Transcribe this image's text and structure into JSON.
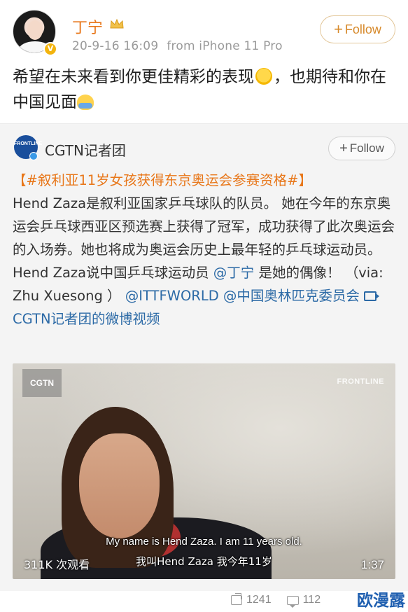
{
  "post": {
    "username": "丁宁",
    "timestamp": "20-9-16 16:09",
    "source": "from iPhone 11 Pro",
    "follow_label": "Follow",
    "text_part1": "希望在未来看到你更佳精彩的表现",
    "text_part2": "，也期待和你在中国见面",
    "emoji_1": "sun-face-icon",
    "emoji_2": "hug-icon"
  },
  "repost": {
    "username": "CGTN记者团",
    "avatar_text": "FRONTLINE",
    "follow_label": "Follow",
    "hashtag": "【#叙利亚11岁女孩获得东京奥运会参赛资格#】",
    "body_1": "Hend Zaza是叙利亚国家乒乓球队的队员。 她在今年的东京奥运会乒乓球西亚区预选赛上获得了冠军，成功获得了此次奥运会的入场券。她也将成为奥运会历史上最年轻的乒乓球运动员。Hend Zaza说中国乒乓球运动员 ",
    "mention_1": "@丁宁",
    "body_2": " 是她的偶像！ （via: Zhu Xuesong ） ",
    "mention_2": "@ITTFWORLD",
    "mention_3": " @中国奥林匹克委员会",
    "video_link": "CGTN记者团的微博视频"
  },
  "video": {
    "channel_tag": "CGTN",
    "frontline_tag": "FRONTLINE",
    "subtitle_en": "My name is Hend Zaza. I am 11 years old.",
    "subtitle_cn": "我叫Hend Zaza 我今年11岁",
    "view_count": "311K 次观看",
    "duration": "1:37"
  },
  "stats": {
    "reposts": "1241",
    "comments": "112"
  },
  "watermark": "欧漫露",
  "colors": {
    "username": "#e8771a",
    "link": "#2c6aa6",
    "hashtag": "#e8771a",
    "repost_bg": "#f4f4f4"
  }
}
